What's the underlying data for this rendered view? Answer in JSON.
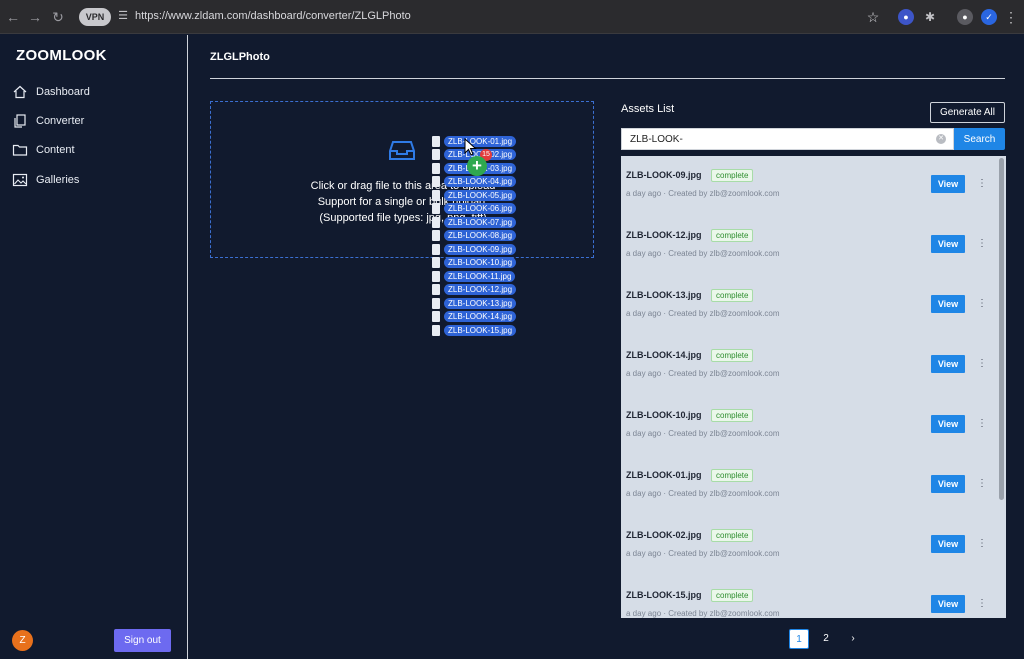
{
  "browser": {
    "vpn_label": "VPN",
    "url": "https://www.zldam.com/dashboard/converter/ZLGLPhoto"
  },
  "sidebar": {
    "logo": "ZOOMLOOK",
    "items": [
      {
        "label": "Dashboard",
        "icon": "home-icon"
      },
      {
        "label": "Converter",
        "icon": "copy-icon"
      },
      {
        "label": "Content",
        "icon": "folder-icon"
      },
      {
        "label": "Galleries",
        "icon": "image-icon"
      }
    ],
    "avatar_initial": "Z",
    "signout_label": "Sign out"
  },
  "main": {
    "page_title": "ZLGLPhoto",
    "upload": {
      "line1": "Click or drag file to this area to upload",
      "line2": "Support for a single or bulk upload.",
      "line3": "(Supported file types: jpg, png, tiff)"
    },
    "drag_ghost": {
      "files": [
        "ZLB-LOOK-01.jpg",
        "ZLB-LOOK-02.jpg",
        "ZLB-LOOK-03.jpg",
        "ZLB-LOOK-04.jpg",
        "ZLB-LOOK-05.jpg",
        "ZLB-LOOK-06.jpg",
        "ZLB-LOOK-07.jpg",
        "ZLB-LOOK-08.jpg",
        "ZLB-LOOK-09.jpg",
        "ZLB-LOOK-10.jpg",
        "ZLB-LOOK-11.jpg",
        "ZLB-LOOK-12.jpg",
        "ZLB-LOOK-13.jpg",
        "ZLB-LOOK-14.jpg",
        "ZLB-LOOK-15.jpg"
      ],
      "count_badge": "15"
    },
    "assets": {
      "title": "Assets List",
      "generate_label": "Generate All",
      "search_value": "ZLB-LOOK-",
      "search_label": "Search",
      "view_label": "View",
      "items": [
        {
          "name": "ZLB-LOOK-09.jpg",
          "status": "complete",
          "age": "a day ago",
          "creator": "Created by zlb@zoomlook.com"
        },
        {
          "name": "ZLB-LOOK-12.jpg",
          "status": "complete",
          "age": "a day ago",
          "creator": "Created by zlb@zoomlook.com"
        },
        {
          "name": "ZLB-LOOK-13.jpg",
          "status": "complete",
          "age": "a day ago",
          "creator": "Created by zlb@zoomlook.com"
        },
        {
          "name": "ZLB-LOOK-14.jpg",
          "status": "complete",
          "age": "a day ago",
          "creator": "Created by zlb@zoomlook.com"
        },
        {
          "name": "ZLB-LOOK-10.jpg",
          "status": "complete",
          "age": "a day ago",
          "creator": "Created by zlb@zoomlook.com"
        },
        {
          "name": "ZLB-LOOK-01.jpg",
          "status": "complete",
          "age": "a day ago",
          "creator": "Created by zlb@zoomlook.com"
        },
        {
          "name": "ZLB-LOOK-02.jpg",
          "status": "complete",
          "age": "a day ago",
          "creator": "Created by zlb@zoomlook.com"
        },
        {
          "name": "ZLB-LOOK-15.jpg",
          "status": "complete",
          "age": "a day ago",
          "creator": "Created by zlb@zoomlook.com"
        }
      ],
      "pagination": {
        "current": "1",
        "other": "2",
        "next": "›"
      }
    }
  },
  "colors": {
    "background": "#111a2e",
    "accent": "#1f86e6",
    "signout": "#6d6af0",
    "complete": "#2f8f2f"
  }
}
